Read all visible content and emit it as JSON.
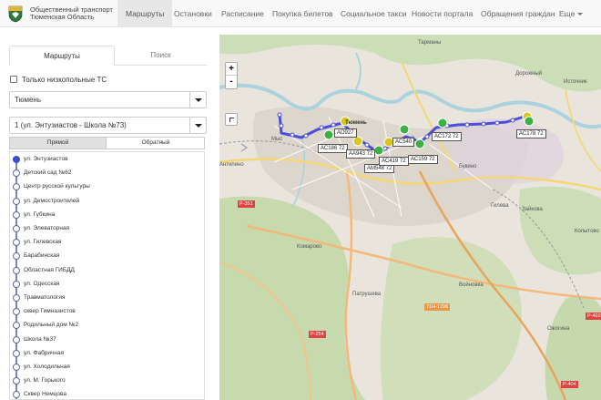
{
  "brand": {
    "line1": "Общественный транспорт",
    "line2": "Тюменская Область"
  },
  "nav": {
    "items": [
      "Маршруты",
      "Остановки",
      "Расписание",
      "Покупка билетов",
      "Социальное такси",
      "Новости портала",
      "Обращения граждан",
      "Еще"
    ],
    "active": "Маршруты"
  },
  "panel": {
    "tabs": {
      "routes": "Маршруты",
      "search": "Поиск"
    },
    "low_floor_label": "Только низкопольные ТС",
    "low_floor_checked": false,
    "city_select": "Тюмень",
    "route_select": "1 (ул. Энтузиастов - Школа №73)",
    "direction": {
      "forward": "Прямой",
      "back": "Обратный",
      "selected": "Прямой"
    }
  },
  "stops": [
    "ул. Энтузиастов",
    "Детский сад №62",
    "Центр русской культуры",
    "ул. Демостроителей",
    "ул. Губкина",
    "ул. Элеваторная",
    "ул. Гилевская",
    "Барабинская",
    "Областная ГИБДД",
    "ул. Одесская",
    "Травматология",
    "сквер Гимназистов",
    "Родильный дом №2",
    "Школа №37",
    "ул. Фабричная",
    "ул. Холодильная",
    "ул. М. Горького",
    "Сквер Немцова"
  ],
  "map": {
    "zoom_in": "+",
    "zoom_out": "-",
    "buses": [
      "АС186 72",
      "АА943 72",
      "АМ548 72",
      "АС419 72",
      "АС159 72",
      "АС172 72",
      "АС178 72",
      "АО927",
      "АС540"
    ],
    "places": [
      "Тарманы",
      "Дорожный",
      "Источник",
      "Мыс",
      "Тюмень",
      "Букино",
      "Гилева",
      "Зайкова",
      "Копытово",
      "Комарово",
      "Патрушева",
      "Войновка",
      "Антипино",
      "Ожогина"
    ],
    "roads": [
      "Р-351",
      "Р-254",
      "Р-402",
      "71Н-1706",
      "Р-404"
    ]
  },
  "colors": {
    "route": "#4b4fd8",
    "bus_green": "#3cb043",
    "bus_yellow": "#d8c81e",
    "river": "#aad3df",
    "forest": "#b5d29e"
  }
}
